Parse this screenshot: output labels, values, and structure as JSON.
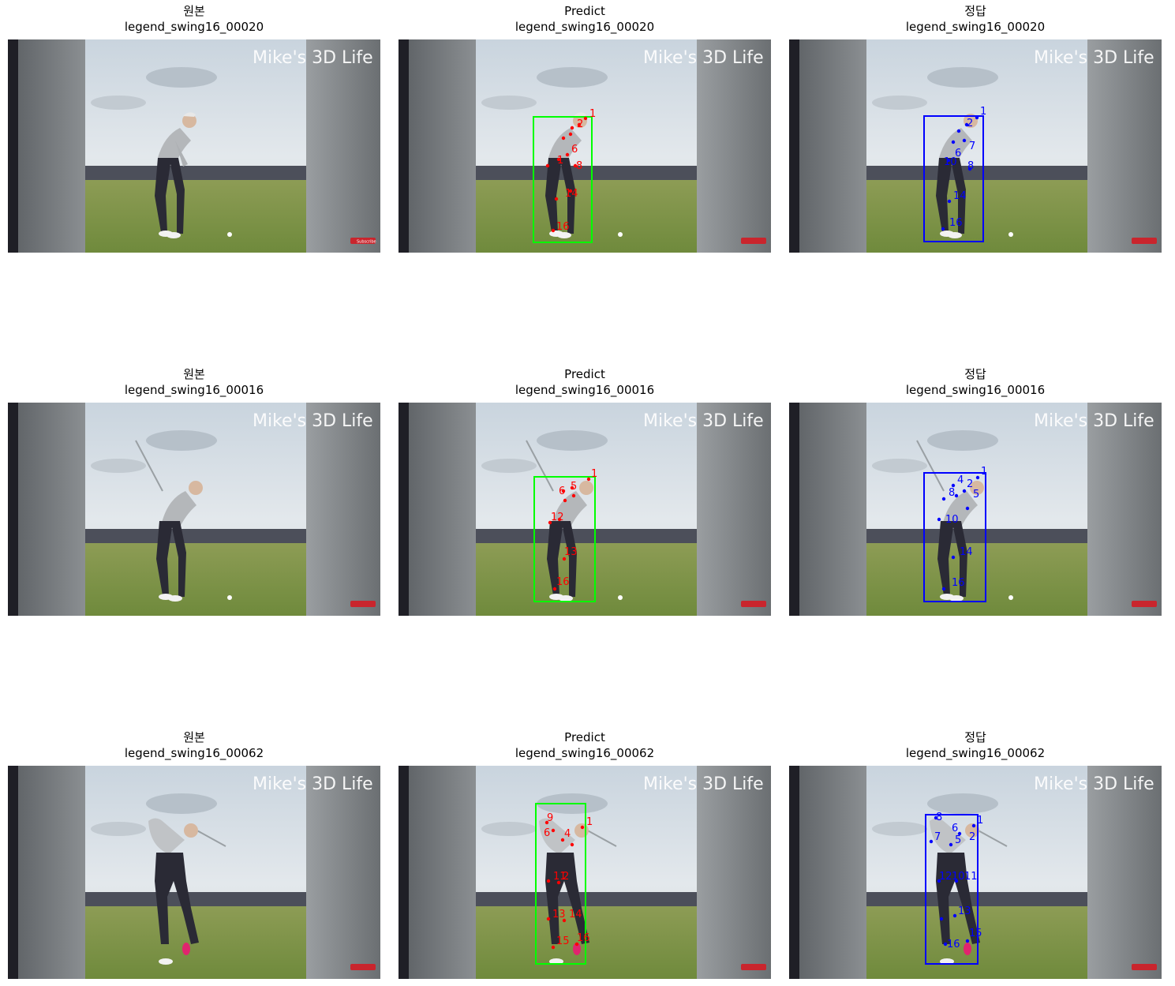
{
  "watermark": "Mike's 3D Life",
  "subscribe_badge": "Subscribe",
  "colors": {
    "predict": "#ff0000",
    "predict_box": "#00ff00",
    "answer": "#0000ff"
  },
  "rows": [
    {
      "panels": [
        {
          "title": "원본",
          "subtitle": "legend_swing16_00020"
        },
        {
          "title": "Predict",
          "subtitle": "legend_swing16_00020"
        },
        {
          "title": "정답",
          "subtitle": "legend_swing16_00020"
        }
      ]
    },
    {
      "panels": [
        {
          "title": "원본",
          "subtitle": "legend_swing16_00016"
        },
        {
          "title": "Predict",
          "subtitle": "legend_swing16_00016"
        },
        {
          "title": "정답",
          "subtitle": "legend_swing16_00016"
        }
      ]
    },
    {
      "panels": [
        {
          "title": "원본",
          "subtitle": "legend_swing16_00062"
        },
        {
          "title": "Predict",
          "subtitle": "legend_swing16_00062"
        },
        {
          "title": "정답",
          "subtitle": "legend_swing16_00062"
        }
      ]
    }
  ]
}
